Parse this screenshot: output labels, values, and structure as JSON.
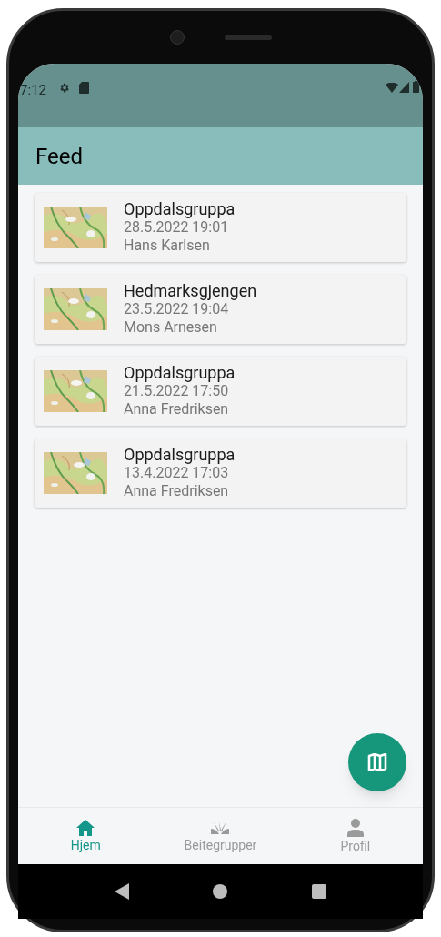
{
  "status_bar": {
    "time": "7:12"
  },
  "app_bar": {
    "title": "Feed"
  },
  "feed": [
    {
      "group": "Oppdalsgruppa",
      "date": "28.5.2022 19:01",
      "author": "Hans Karlsen"
    },
    {
      "group": "Hedmarksgjengen",
      "date": "23.5.2022 19:04",
      "author": "Mons Arnesen"
    },
    {
      "group": "Oppdalsgruppa",
      "date": "21.5.2022 17:50",
      "author": "Anna Fredriksen"
    },
    {
      "group": "Oppdalsgruppa",
      "date": "13.4.2022 17:03",
      "author": "Anna Fredriksen"
    }
  ],
  "bottom_nav": [
    {
      "kind": "home",
      "label": "Hjem",
      "selected": true
    },
    {
      "kind": "groups",
      "label": "Beitegrupper",
      "selected": false
    },
    {
      "kind": "profile",
      "label": "Profil",
      "selected": false
    }
  ]
}
